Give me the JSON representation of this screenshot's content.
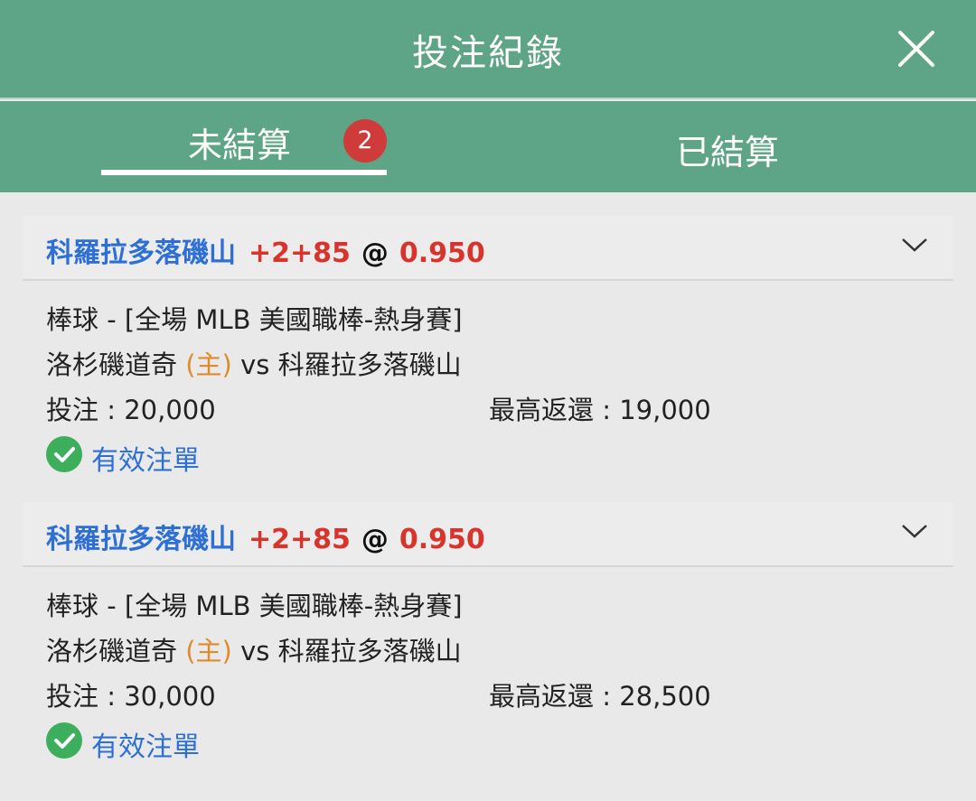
{
  "header": {
    "title": "投注紀錄"
  },
  "tabs": [
    {
      "label": "未結算",
      "badge": "2",
      "active": true
    },
    {
      "label": "已結算",
      "active": false
    }
  ],
  "colors": {
    "header_bg": "#5ea486",
    "team": "#2e6fd6",
    "odds": "#d8342c",
    "home": "#e08a2a",
    "badge": "#cf3b3b",
    "valid": "#3dae5c"
  },
  "bets": [
    {
      "team": "科羅拉多落磯山",
      "handicap": "+2+85",
      "at": "@",
      "odds": "0.950",
      "sport_line": "棒球 - [全場 MLB 美國職棒-熱身賽]",
      "home_team": "洛杉磯道奇",
      "home_tag": "(主)",
      "vs_away": "vs 科羅拉多落磯山",
      "stake": "投注 : 20,000",
      "max_return": "最高返還 : 19,000",
      "status": "有效注單"
    },
    {
      "team": "科羅拉多落磯山",
      "handicap": "+2+85",
      "at": "@",
      "odds": "0.950",
      "sport_line": "棒球 - [全場 MLB 美國職棒-熱身賽]",
      "home_team": "洛杉磯道奇",
      "home_tag": "(主)",
      "vs_away": "vs 科羅拉多落磯山",
      "stake": "投注 : 30,000",
      "max_return": "最高返還 : 28,500",
      "status": "有效注單"
    }
  ]
}
